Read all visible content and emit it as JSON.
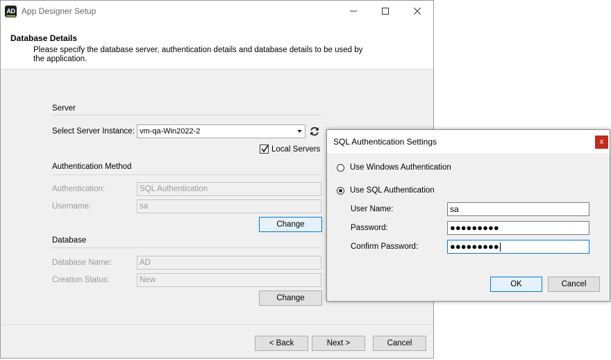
{
  "window": {
    "title": "App Designer Setup",
    "icon_text": "AD",
    "controls": {
      "minimize": "—",
      "maximize": "☐",
      "close": "✕"
    }
  },
  "header": {
    "title": "Database Details",
    "description": "Please specify the database server, authentication details and database details to be used by the application."
  },
  "server": {
    "section_label": "Server",
    "select_label": "Select Server Instance:",
    "instance_value": "vm-qa-Win2022-2",
    "local_servers_label": "Local Servers",
    "local_servers_checked": true
  },
  "auth_method": {
    "section_label": "Authentication Method",
    "auth_label": "Authentication:",
    "auth_value": "SQL Authentication",
    "username_label": "Username:",
    "username_value": "sa",
    "change_label": "Change"
  },
  "database": {
    "section_label": "Database",
    "name_label": "Database Name:",
    "name_value": "AD",
    "status_label": "Creation Status:",
    "status_value": "New",
    "change_label": "Change"
  },
  "footer": {
    "back_label": "< Back",
    "next_label": "Next >",
    "cancel_label": "Cancel"
  },
  "dialog": {
    "title": "SQL Authentication Settings",
    "close_glyph": "x",
    "windows_auth_label": "Use Windows Authentication",
    "sql_auth_label": "Use SQL Authentication",
    "selected": "sql",
    "user_name_label": "User Name:",
    "user_name_value": "sa",
    "password_label": "Password:",
    "password_value": "●●●●●●●●●",
    "confirm_label": "Confirm Password:",
    "confirm_value": "●●●●●●●●●",
    "ok_label": "OK",
    "cancel_label": "Cancel"
  },
  "colors": {
    "window_bg": "#f0f0f0",
    "focus_border": "#0078d7",
    "close_red": "#c42b1c",
    "disabled_text": "#9a9a9a"
  }
}
